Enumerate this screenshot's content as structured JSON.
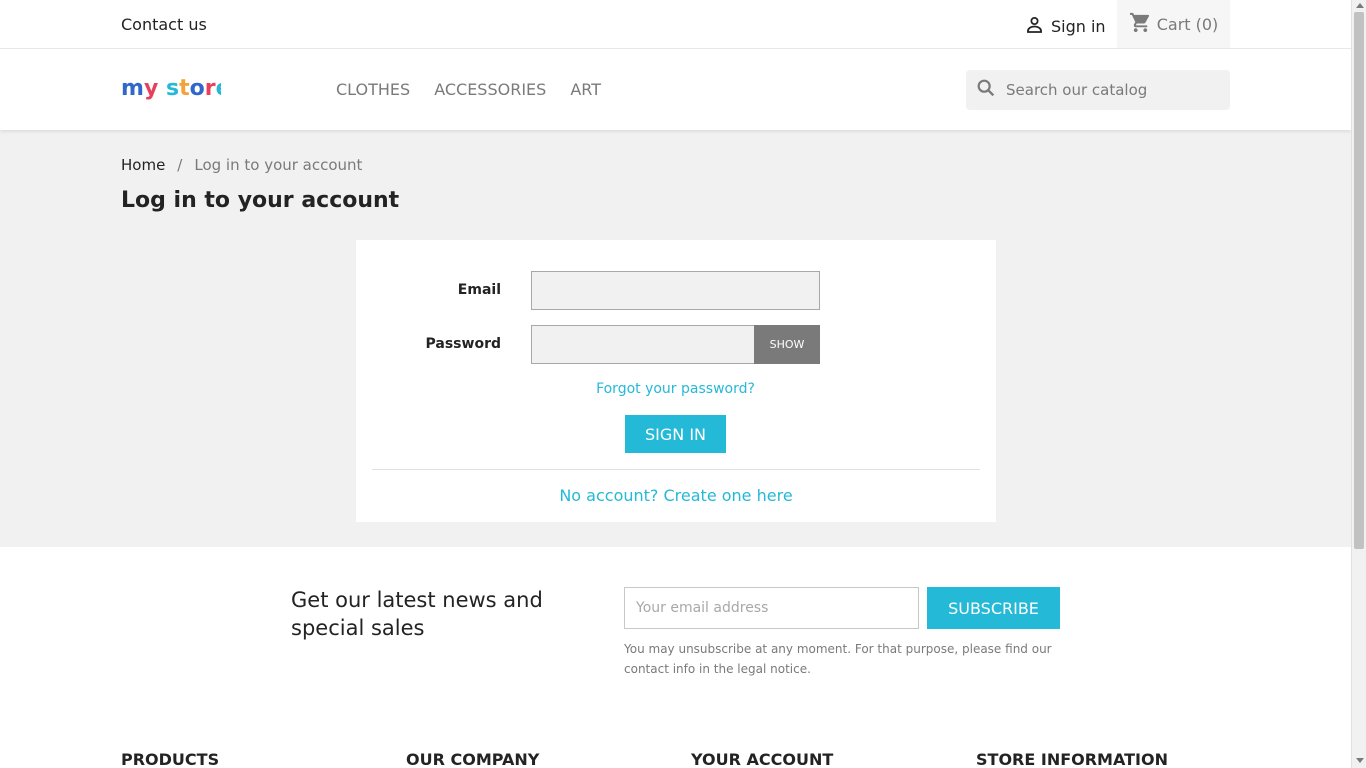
{
  "topbar": {
    "contact_label": "Contact us",
    "signin_label": "Sign in",
    "cart_label": "Cart",
    "cart_count": "(0)"
  },
  "header": {
    "logo_alt": "my store",
    "nav": [
      "CLOTHES",
      "ACCESSORIES",
      "ART"
    ],
    "search_placeholder": "Search our catalog"
  },
  "breadcrumb": {
    "home": "Home",
    "separator": "/",
    "current": "Log in to your account"
  },
  "page": {
    "title": "Log in to your account"
  },
  "login": {
    "email_label": "Email",
    "password_label": "Password",
    "show_label": "SHOW",
    "forgot_label": "Forgot your password?",
    "signin_label": "SIGN IN",
    "no_account_label": "No account? Create one here"
  },
  "newsletter": {
    "title": "Get our latest news and special sales",
    "email_placeholder": "Your email address",
    "subscribe_label": "SUBSCRIBE",
    "note": "You may unsubscribe at any moment. For that purpose, please find our contact info in the legal notice."
  },
  "footer": {
    "columns": [
      "PRODUCTS",
      "OUR COMPANY",
      "YOUR ACCOUNT",
      "STORE INFORMATION"
    ]
  },
  "colors": {
    "accent": "#24b9d7",
    "text": "#232323",
    "muted": "#7a7a7a",
    "page_bg": "#f1f1f1"
  },
  "icons": {
    "user": "person-icon",
    "cart": "shopping-cart-icon",
    "search": "magnifier-icon"
  }
}
